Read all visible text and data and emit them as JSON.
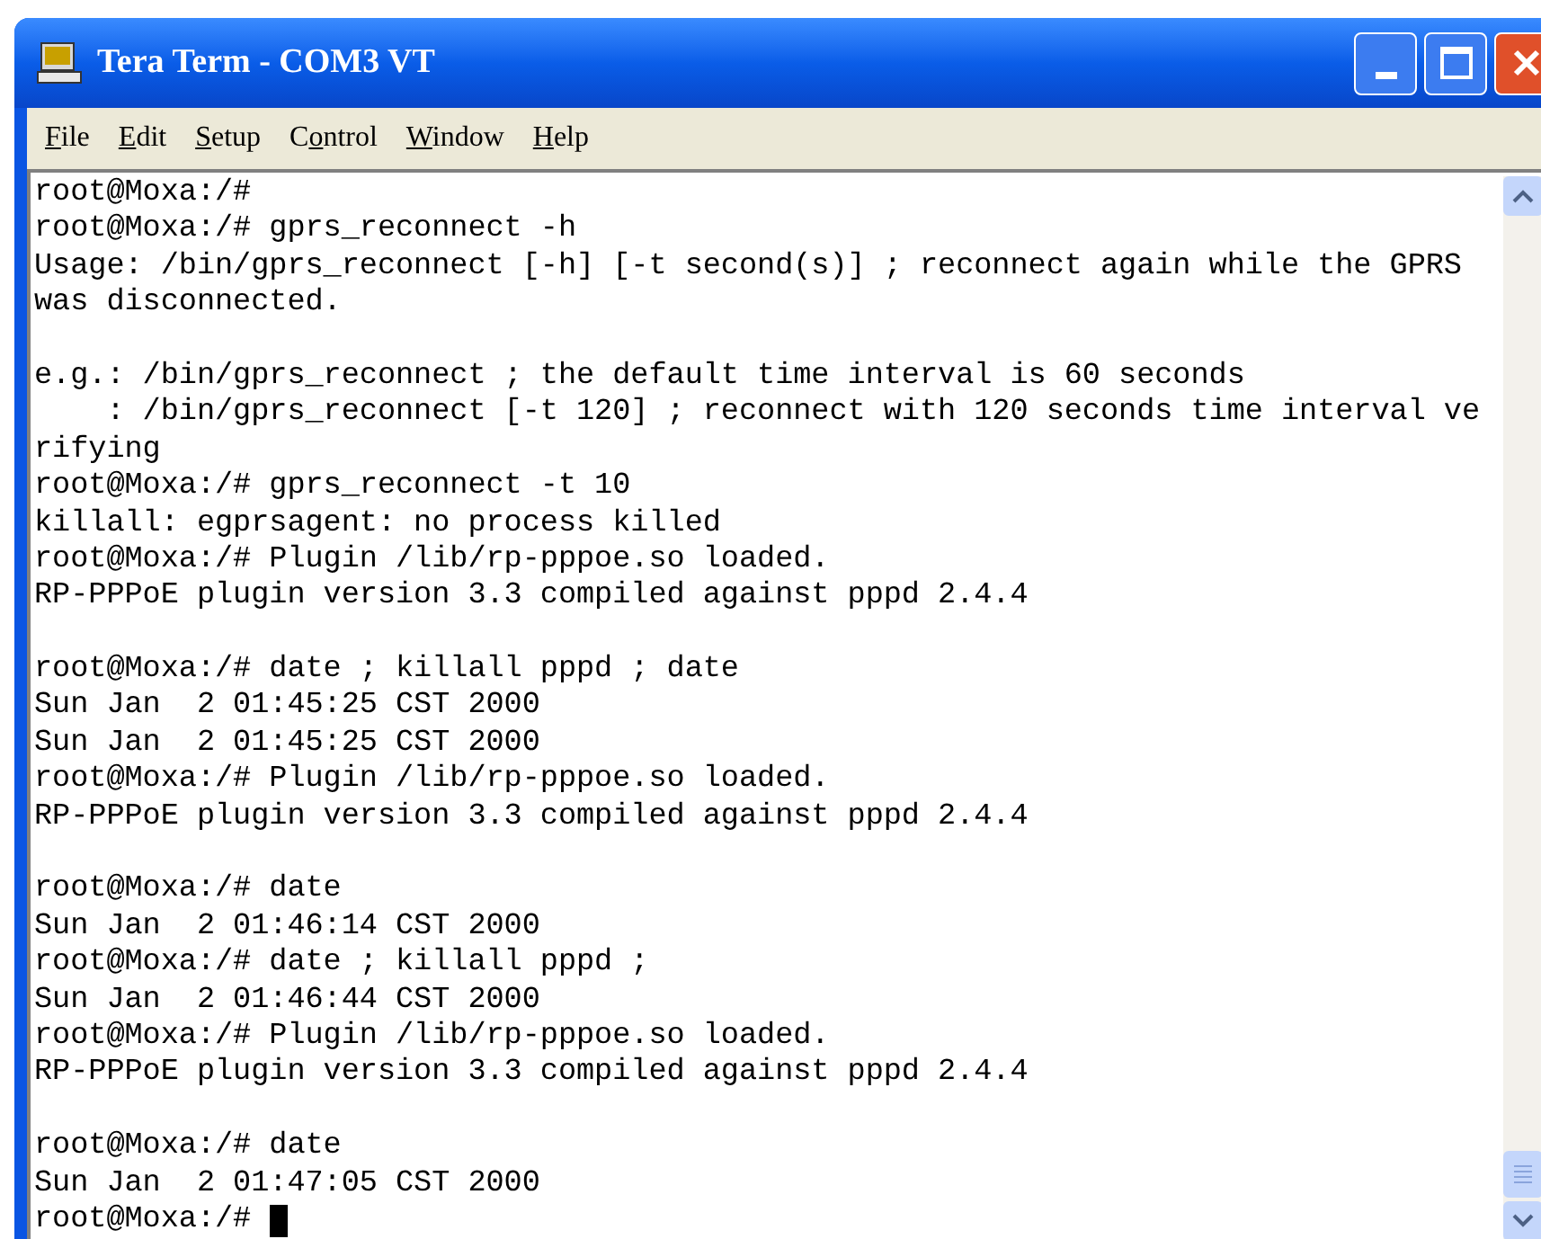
{
  "window": {
    "title": "Tera Term - COM3 VT"
  },
  "menu": [
    {
      "parts": [
        {
          "text": "F",
          "underlined": true
        },
        {
          "text": "ile",
          "underlined": false
        }
      ]
    },
    {
      "parts": [
        {
          "text": "E",
          "underlined": true
        },
        {
          "text": "dit",
          "underlined": false
        }
      ]
    },
    {
      "parts": [
        {
          "text": "S",
          "underlined": true
        },
        {
          "text": "etup",
          "underlined": false
        }
      ]
    },
    {
      "parts": [
        {
          "text": "C",
          "underlined": false
        },
        {
          "text": "o",
          "underlined": true
        },
        {
          "text": "ntrol",
          "underlined": false
        }
      ]
    },
    {
      "parts": [
        {
          "text": "W",
          "underlined": true
        },
        {
          "text": "indow",
          "underlined": false
        }
      ]
    },
    {
      "parts": [
        {
          "text": "H",
          "underlined": true
        },
        {
          "text": "elp",
          "underlined": false
        }
      ]
    }
  ],
  "terminal": {
    "lines": [
      {
        "kind": "text",
        "text": "root@Moxa:/#"
      },
      {
        "kind": "text",
        "text": "root@Moxa:/# gprs_reconnect -h"
      },
      {
        "kind": "text",
        "text": "Usage: /bin/gprs_reconnect [-h] [-t second(s)] ; reconnect again while the GPRS"
      },
      {
        "kind": "text",
        "text": "was disconnected."
      },
      {
        "kind": "blank"
      },
      {
        "kind": "text",
        "text": "e.g.: /bin/gprs_reconnect ; the default time interval is 60 seconds"
      },
      {
        "kind": "text",
        "text": "    : /bin/gprs_reconnect [-t 120] ; reconnect with 120 seconds time interval ve"
      },
      {
        "kind": "text",
        "text": "rifying"
      },
      {
        "kind": "text",
        "text": "root@Moxa:/# gprs_reconnect -t 10"
      },
      {
        "kind": "text",
        "text": "killall: egprsagent: no process killed"
      },
      {
        "kind": "text",
        "text": "root@Moxa:/# Plugin /lib/rp-pppoe.so loaded."
      },
      {
        "kind": "text",
        "text": "RP-PPPoE plugin version 3.3 compiled against pppd 2.4.4"
      },
      {
        "kind": "blank"
      },
      {
        "kind": "text",
        "text": "root@Moxa:/# date ; killall pppd ; date"
      },
      {
        "kind": "text",
        "text": "Sun Jan  2 01:45:25 CST 2000"
      },
      {
        "kind": "text",
        "text": "Sun Jan  2 01:45:25 CST 2000"
      },
      {
        "kind": "text",
        "text": "root@Moxa:/# Plugin /lib/rp-pppoe.so loaded."
      },
      {
        "kind": "text",
        "text": "RP-PPPoE plugin version 3.3 compiled against pppd 2.4.4"
      },
      {
        "kind": "blank"
      },
      {
        "kind": "text",
        "text": "root@Moxa:/# date"
      },
      {
        "kind": "text",
        "text": "Sun Jan  2 01:46:14 CST 2000"
      },
      {
        "kind": "text",
        "text": "root@Moxa:/# date ; killall pppd ;"
      },
      {
        "kind": "text",
        "text": "Sun Jan  2 01:46:44 CST 2000"
      },
      {
        "kind": "text",
        "text": "root@Moxa:/# Plugin /lib/rp-pppoe.so loaded."
      },
      {
        "kind": "text",
        "text": "RP-PPPoE plugin version 3.3 compiled against pppd 2.4.4"
      },
      {
        "kind": "blank"
      },
      {
        "kind": "text",
        "text": "root@Moxa:/# date"
      },
      {
        "kind": "text",
        "text": "Sun Jan  2 01:47:05 CST 2000"
      },
      {
        "kind": "prompt",
        "text": "root@Moxa:/#",
        "cursor": true
      }
    ]
  }
}
